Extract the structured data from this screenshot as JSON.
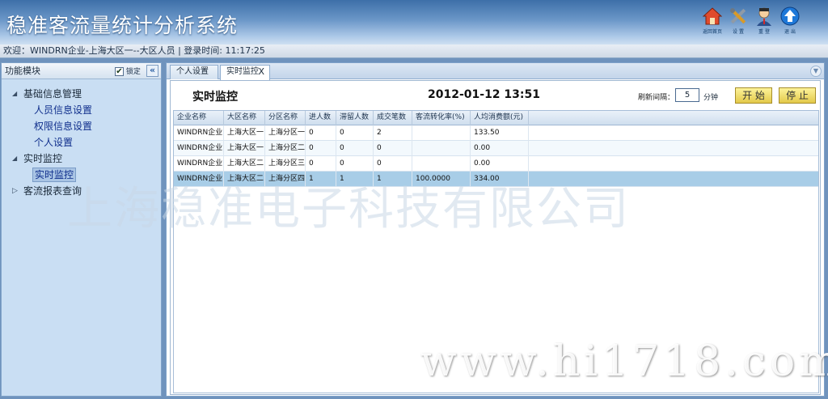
{
  "header": {
    "title": "稳准客流量统计分析系统",
    "tools": [
      {
        "label": "返回首页",
        "icon": "home-icon"
      },
      {
        "label": "设 置",
        "icon": "tools-icon"
      },
      {
        "label": "重 登",
        "icon": "user-icon"
      },
      {
        "label": "退 出",
        "icon": "exit-icon"
      }
    ]
  },
  "welcome": "欢迎：WINDRN企业-上海大区一--大区人员 | 登录时间: 11:17:25",
  "sidebar": {
    "title": "功能模块",
    "lock_label": "锁定",
    "items": [
      {
        "label": "基础信息管理",
        "level": 0,
        "expanded": true
      },
      {
        "label": "人员信息设置",
        "level": 1
      },
      {
        "label": "权限信息设置",
        "level": 1
      },
      {
        "label": "个人设置",
        "level": 1
      },
      {
        "label": "实时监控",
        "level": 0,
        "expanded": true
      },
      {
        "label": "实时监控",
        "level": 1,
        "selected": true
      },
      {
        "label": "客流报表查询",
        "level": 0,
        "expanded": false
      }
    ]
  },
  "tabs": [
    {
      "label": "个人设置"
    },
    {
      "label": "实时监控",
      "close": "X",
      "active": true
    }
  ],
  "panel": {
    "title": "实时监控",
    "datetime": "2012-01-12 13:51",
    "refresh_label": "刷新间隔：",
    "refresh_value": "5",
    "refresh_unit": "分钟",
    "start_label": "开 始",
    "stop_label": "停 止"
  },
  "table": {
    "headers": [
      "企业名称",
      "大区名称",
      "分区名称",
      "进人数",
      "滞留人数",
      "成交笔数",
      "客流转化率(%)",
      "人均消费额(元)"
    ],
    "rows": [
      [
        "WINDRN企业",
        "上海大区一",
        "上海分区一",
        "0",
        "0",
        "2",
        "",
        "133.50"
      ],
      [
        "WINDRN企业",
        "上海大区一",
        "上海分区二",
        "0",
        "0",
        "0",
        "",
        "0.00"
      ],
      [
        "WINDRN企业",
        "上海大区二",
        "上海分区三",
        "0",
        "0",
        "0",
        "",
        "0.00"
      ],
      [
        "WINDRN企业",
        "上海大区二",
        "上海分区四",
        "1",
        "1",
        "1",
        "100.0000",
        "334.00"
      ]
    ]
  },
  "watermarks": {
    "company": "上海稳准电子科技有限公司",
    "site": "www.hi1718.com"
  }
}
